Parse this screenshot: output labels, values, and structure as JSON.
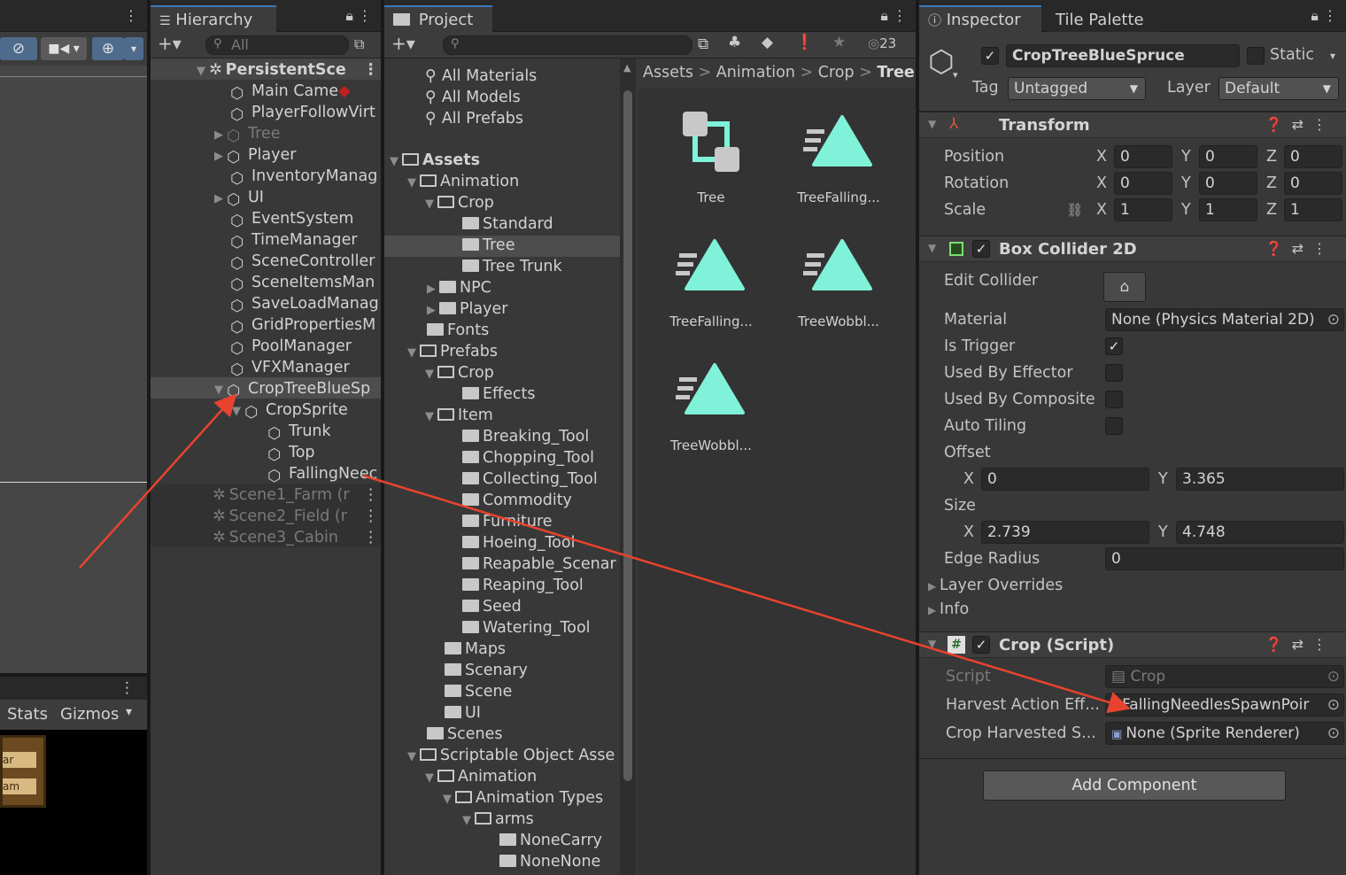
{
  "hierarchy": {
    "tab": "Hierarchy",
    "search_placeholder": "All",
    "items": [
      {
        "label": "PersistentSce"
      },
      {
        "label": "Main Came"
      },
      {
        "label": "PlayerFollowVirt"
      },
      {
        "label": "Tree"
      },
      {
        "label": "Player"
      },
      {
        "label": "InventoryManag"
      },
      {
        "label": "UI"
      },
      {
        "label": "EventSystem"
      },
      {
        "label": "TimeManager"
      },
      {
        "label": "SceneController"
      },
      {
        "label": "SceneItemsMan"
      },
      {
        "label": "SaveLoadManag"
      },
      {
        "label": "GridPropertiesM"
      },
      {
        "label": "PoolManager"
      },
      {
        "label": "VFXManager"
      },
      {
        "label": "CropTreeBlueSp"
      },
      {
        "label": "CropSprite"
      },
      {
        "label": "Trunk"
      },
      {
        "label": "Top"
      },
      {
        "label": "FallingNeec"
      },
      {
        "label": "Scene1_Farm (r"
      },
      {
        "label": "Scene2_Field (r"
      },
      {
        "label": "Scene3_Cabin"
      }
    ]
  },
  "scene": {
    "stats": "Stats",
    "gizmos": "Gizmos",
    "sign1": "ar",
    "sign2": "am"
  },
  "project": {
    "tab": "Project",
    "count": "23",
    "favorites": [
      "All Materials",
      "All Models",
      "All Prefabs"
    ],
    "tree": [
      "Assets",
      "Animation",
      "Crop",
      "Standard",
      "Tree",
      "Tree Trunk",
      "NPC",
      "Player",
      "Fonts",
      "Prefabs",
      "Crop",
      "Effects",
      "Item",
      "Breaking_Tool",
      "Chopping_Tool",
      "Collecting_Tool",
      "Commodity",
      "Furniture",
      "Hoeing_Tool",
      "Reapable_Scenar",
      "Reaping_Tool",
      "Seed",
      "Watering_Tool",
      "Maps",
      "Scenary",
      "Scene",
      "UI",
      "Scenes",
      "Scriptable Object Asse",
      "Animation",
      "Animation Types",
      "arms",
      "NoneCarry",
      "NoneNone"
    ],
    "breadcrumb": [
      "Assets",
      "Animation",
      "Crop",
      "Tree"
    ],
    "assets": [
      "Tree",
      "TreeFalling...",
      "TreeFalling...",
      "TreeWobbl...",
      "TreeWobbl..."
    ]
  },
  "inspector": {
    "tab": "Inspector",
    "tab2": "Tile Palette",
    "object_name": "CropTreeBlueSpruce",
    "static_label": "Static",
    "tag_label": "Tag",
    "tag_value": "Untagged",
    "layer_label": "Layer",
    "layer_value": "Default",
    "transform": {
      "title": "Transform",
      "position_label": "Position",
      "position": [
        "0",
        "0",
        "0"
      ],
      "rotation_label": "Rotation",
      "rotation": [
        "0",
        "0",
        "0"
      ],
      "scale_label": "Scale",
      "scale": [
        "1",
        "1",
        "1"
      ],
      "x": "X",
      "y": "Y",
      "z": "Z"
    },
    "collider": {
      "title": "Box Collider 2D",
      "edit_label": "Edit Collider",
      "material_label": "Material",
      "material_value": "None (Physics Material 2D)",
      "trigger_label": "Is Trigger",
      "effector_label": "Used By Effector",
      "composite_label": "Used By Composite",
      "tiling_label": "Auto Tiling",
      "offset_label": "Offset",
      "offset_x": "0",
      "offset_y": "3.365",
      "size_label": "Size",
      "size_x": "2.739",
      "size_y": "4.748",
      "edge_label": "Edge Radius",
      "edge_value": "0",
      "overrides_label": "Layer Overrides",
      "info_label": "Info"
    },
    "crop": {
      "title": "Crop (Script)",
      "script_label": "Script",
      "script_value": "Crop",
      "harvest_label": "Harvest Action Eff...",
      "harvest_value": "FallingNeedlesSpawnPoir",
      "harvested_label": "Crop Harvested S...",
      "harvested_value": "None (Sprite Renderer)"
    },
    "add_component": "Add Component"
  },
  "colors": {
    "accent": "#7ff2d9",
    "arrow": "#e8432f",
    "selection": "#4d4d4d"
  }
}
